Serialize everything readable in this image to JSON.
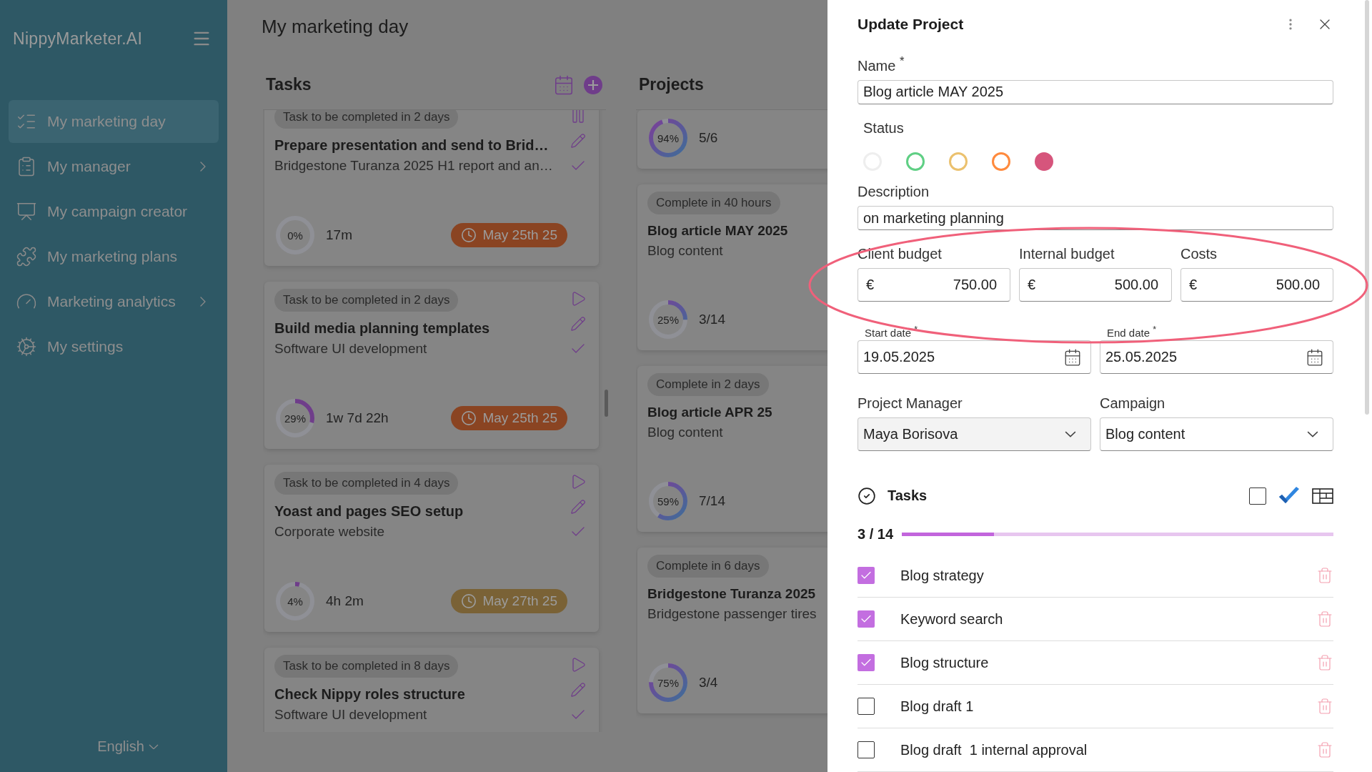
{
  "sidebar": {
    "logo": "NippyMarketer.AI",
    "items": [
      {
        "kind": "day",
        "label": "My marketing day",
        "selected": true,
        "expandable": false
      },
      {
        "kind": "manager",
        "label": "My manager",
        "selected": false,
        "expandable": true
      },
      {
        "kind": "campaign",
        "label": "My campaign creator",
        "selected": false,
        "expandable": false
      },
      {
        "kind": "plans",
        "label": "My marketing plans",
        "selected": false,
        "expandable": false
      },
      {
        "kind": "analytics",
        "label": "Marketing analytics",
        "selected": false,
        "expandable": true
      },
      {
        "kind": "settings",
        "label": "My settings",
        "selected": false,
        "expandable": false
      }
    ],
    "language": "English"
  },
  "main": {
    "title": "My marketing day",
    "tasks": {
      "title": "Tasks",
      "cards": [
        {
          "tag": "Task to be completed in 2 days",
          "title": "Prepare presentation and send to Brid…",
          "subtitle": "Bridgestone Turanza 2025 H1 report and an…",
          "running": true,
          "level": 0,
          "percent": "0%",
          "duration": "17m",
          "due": "May 25th 25",
          "color": "#8a4422"
        },
        {
          "tag": "Task to be completed in 2 days",
          "title": "Build media planning templates",
          "subtitle": "Software UI development",
          "running": false,
          "level": 0.29,
          "percent": "29%",
          "duration": "1w 7d 22h",
          "due": "May 25th 25",
          "color": "#8a4422"
        },
        {
          "tag": "Task to be completed in 4 days",
          "title": "Yoast and pages SEO setup",
          "subtitle": "Corporate website",
          "running": false,
          "level": 0.04,
          "percent": "4%",
          "duration": "4h 2m",
          "due": "May 27th 25",
          "color": "#7a6236"
        },
        {
          "tag": "Task to be completed in 8 days",
          "title": "Check Nippy roles structure",
          "subtitle": "Software UI development",
          "running": false
        }
      ]
    },
    "projects": {
      "title": "Projects",
      "cards": [
        {
          "level": 0.94,
          "percent": "94%",
          "count": "5/6"
        },
        {
          "tag": "Complete in 40 hours",
          "title": "Blog article MAY 2025",
          "subtitle": "Blog content",
          "level": 0.25,
          "percent": "25%",
          "count": "3/14"
        },
        {
          "tag": "Complete in 2 days",
          "title": "Blog article APR 25",
          "subtitle": "Blog content",
          "level": 0.59,
          "percent": "59%",
          "count": "7/14"
        },
        {
          "tag": "Complete in 6 days",
          "title": "Bridgestone Turanza 2025",
          "subtitle": "Bridgestone passenger tires",
          "level": 0.75,
          "percent": "75%",
          "count": "3/4"
        }
      ]
    }
  },
  "drawer": {
    "title": "Update Project",
    "name": {
      "label": "Name $^{*}$",
      "value": "Blog article MAY 2025"
    },
    "status": {
      "label": "Status",
      "options": [
        {
          "color": "#eeeeee",
          "selected": false
        },
        {
          "color": "#5fcf84",
          "selected": false
        },
        {
          "color": "#ebc16e",
          "selected": false
        },
        {
          "color": "#ff8a3d",
          "selected": false
        },
        {
          "color": "#d6557c",
          "selected": true
        }
      ]
    },
    "description": {
      "label": "Description",
      "value": "on marketing planning"
    },
    "budgets": [
      {
        "label": "Client budget",
        "currency": "€",
        "value": "750.00"
      },
      {
        "label": "Internal budget",
        "currency": "€",
        "value": "500.00"
      },
      {
        "label": "Costs",
        "currency": "€",
        "value": "500.00"
      }
    ],
    "dates": [
      {
        "label": "Start date $^{*}$",
        "value": "19.05.2025"
      },
      {
        "label": "End date $^{*}$",
        "value": "25.05.2025"
      }
    ],
    "selects": [
      {
        "label": "Project Manager",
        "value": "Maya Borisova",
        "disabled": true
      },
      {
        "label": "Campaign",
        "value": "Blog content",
        "disabled": false
      }
    ],
    "checklist": {
      "title": "Tasks",
      "select_all": {
        "checked": false
      },
      "progress": "3 / 14",
      "level": 0.214,
      "items": [
        {
          "label": "Blog strategy",
          "checked": true
        },
        {
          "label": "Keyword search",
          "checked": true
        },
        {
          "label": "Blog structure",
          "checked": true
        },
        {
          "label": "Blog draft 1",
          "checked": false
        },
        {
          "label": "Blog draft  1 internal approval",
          "checked": false
        }
      ]
    }
  }
}
